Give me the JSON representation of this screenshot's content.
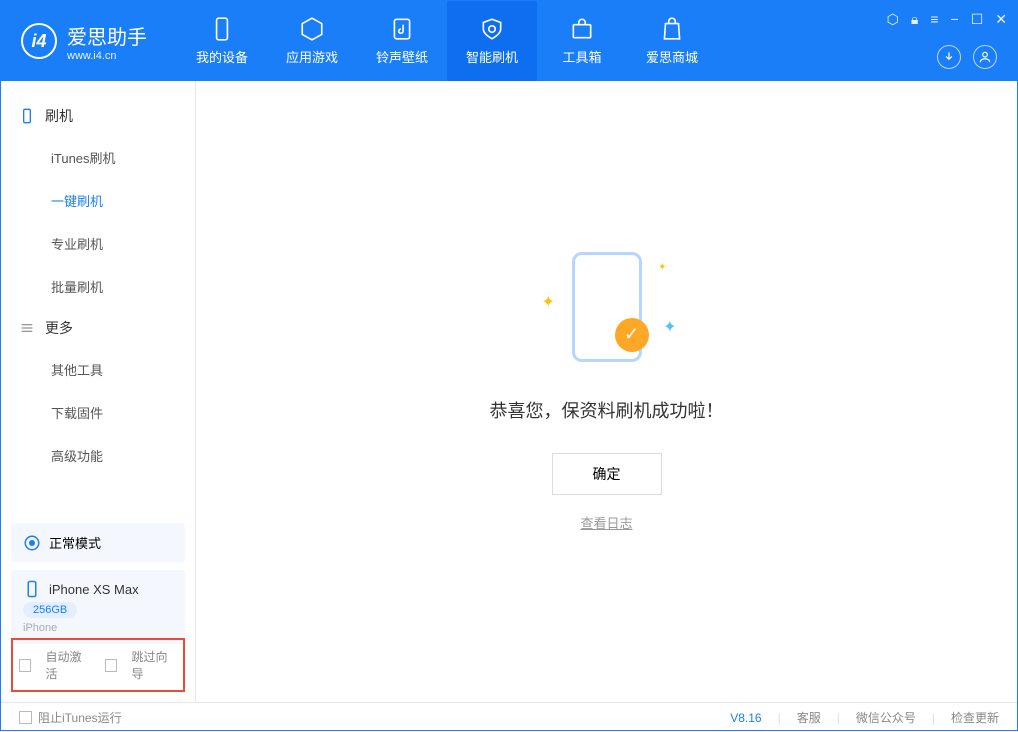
{
  "app": {
    "name": "爱思助手",
    "domain": "www.i4.cn"
  },
  "nav": {
    "tabs": [
      {
        "label": "我的设备"
      },
      {
        "label": "应用游戏"
      },
      {
        "label": "铃声壁纸"
      },
      {
        "label": "智能刷机"
      },
      {
        "label": "工具箱"
      },
      {
        "label": "爱思商城"
      }
    ]
  },
  "sidebar": {
    "section1": {
      "title": "刷机",
      "items": [
        "iTunes刷机",
        "一键刷机",
        "专业刷机",
        "批量刷机"
      ]
    },
    "section2": {
      "title": "更多",
      "items": [
        "其他工具",
        "下载固件",
        "高级功能"
      ]
    },
    "mode": "正常模式",
    "device": {
      "name": "iPhone XS Max",
      "storage": "256GB",
      "type": "iPhone"
    },
    "cb1": "自动激活",
    "cb2": "跳过向导"
  },
  "main": {
    "message": "恭喜您，保资料刷机成功啦！",
    "ok": "确定",
    "log": "查看日志"
  },
  "footer": {
    "block_itunes": "阻止iTunes运行",
    "version": "V8.16",
    "links": [
      "客服",
      "微信公众号",
      "检查更新"
    ]
  }
}
